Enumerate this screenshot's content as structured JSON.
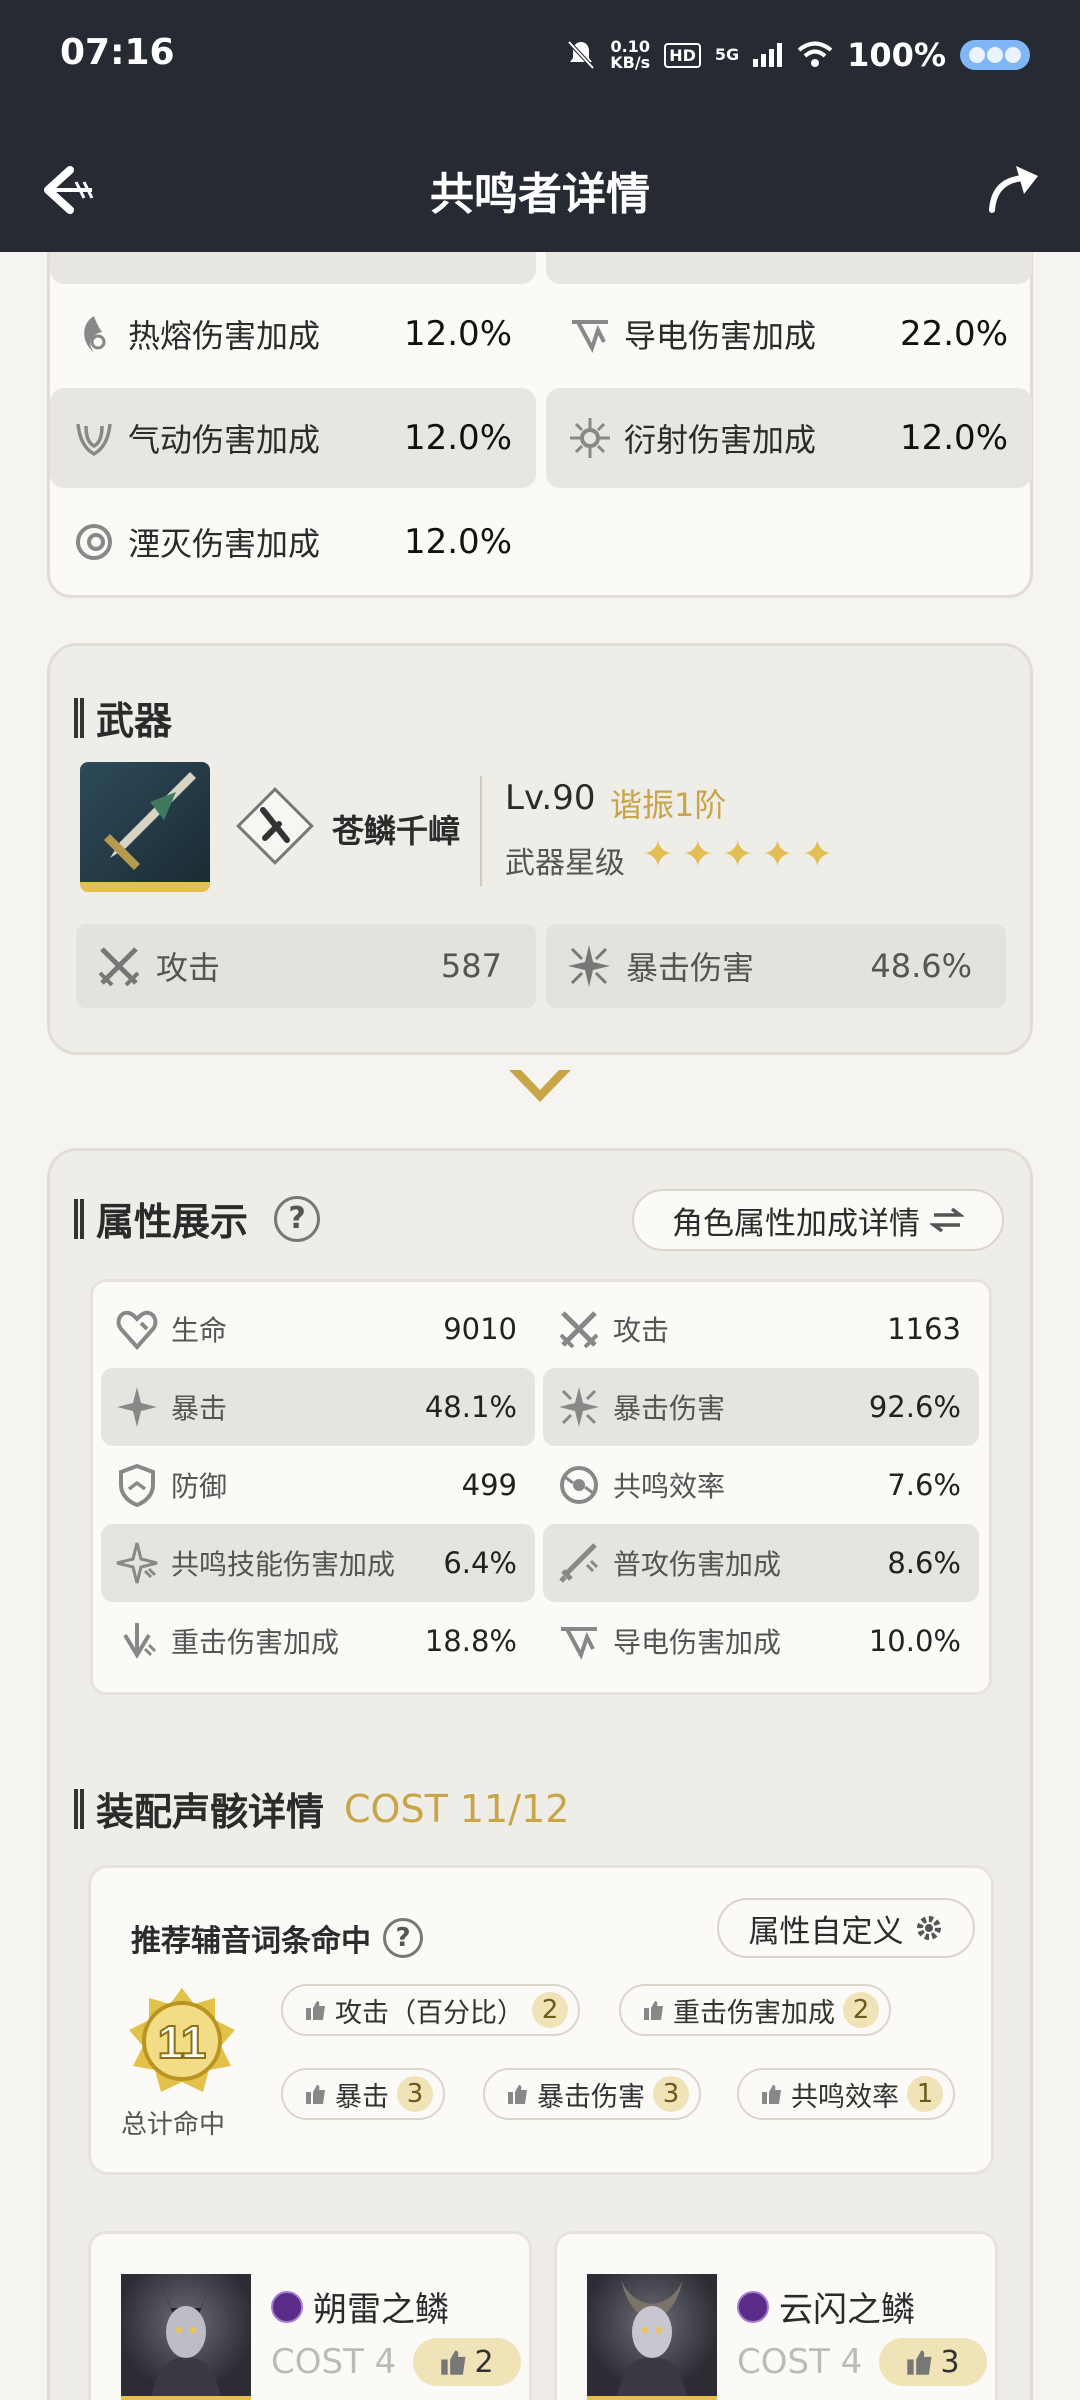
{
  "status": {
    "time": "07:16",
    "net_speed_value": "0.10",
    "net_speed_unit": "KB/s",
    "hd": "HD",
    "signal": "5G",
    "battery": "100%"
  },
  "header": {
    "title": "共鸣者详情"
  },
  "damage_card": {
    "rows": [
      {
        "label": "热熔伤害加成",
        "value": "12.0%",
        "icon": "fusion-icon"
      },
      {
        "label": "导电伤害加成",
        "value": "22.0%",
        "icon": "electro-icon"
      },
      {
        "label": "气动伤害加成",
        "value": "12.0%",
        "icon": "aero-icon"
      },
      {
        "label": "衍射伤害加成",
        "value": "12.0%",
        "icon": "spectro-icon"
      },
      {
        "label": "湮灭伤害加成",
        "value": "12.0%",
        "icon": "havoc-icon"
      }
    ]
  },
  "weapon": {
    "section_title": "武器",
    "name": "苍鳞千嶂",
    "level": "Lv.90",
    "tune": "谐振1阶",
    "star_label": "武器星级",
    "stars": 5,
    "stats": [
      {
        "label": "攻击",
        "value": "587",
        "icon": "attack-icon"
      },
      {
        "label": "暴击伤害",
        "value": "48.6%",
        "icon": "crit-damage-icon"
      }
    ]
  },
  "attributes": {
    "section_title": "属性展示",
    "help": "?",
    "detail_button": "角色属性加成详情",
    "rows": [
      {
        "label": "生命",
        "value": "9010",
        "icon": "hp-icon"
      },
      {
        "label": "攻击",
        "value": "1163",
        "icon": "attack-icon"
      },
      {
        "label": "暴击",
        "value": "48.1%",
        "icon": "crit-icon"
      },
      {
        "label": "暴击伤害",
        "value": "92.6%",
        "icon": "crit-damage-icon"
      },
      {
        "label": "防御",
        "value": "499",
        "icon": "defense-icon"
      },
      {
        "label": "共鸣效率",
        "value": "7.6%",
        "icon": "energy-regen-icon"
      },
      {
        "label": "共鸣技能伤害加成",
        "value": "6.4%",
        "icon": "skill-dmg-icon"
      },
      {
        "label": "普攻伤害加成",
        "value": "8.6%",
        "icon": "basic-attack-icon"
      },
      {
        "label": "重击伤害加成",
        "value": "18.8%",
        "icon": "heavy-attack-icon"
      },
      {
        "label": "导电伤害加成",
        "value": "10.0%",
        "icon": "electro-icon"
      }
    ]
  },
  "echoes": {
    "section_title": "装配声骸详情",
    "cost": "COST 11/12",
    "reco_title": "推荐辅音词条命中",
    "help": "?",
    "custom_button": "属性自定义",
    "total_hits": "11",
    "total_label": "总计命中",
    "tags": [
      {
        "label": "攻击（百分比）",
        "count": "2"
      },
      {
        "label": "重击伤害加成",
        "count": "2"
      },
      {
        "label": "暴击",
        "count": "3"
      },
      {
        "label": "暴击伤害",
        "count": "3"
      },
      {
        "label": "共鸣效率",
        "count": "1"
      }
    ],
    "cards": [
      {
        "name": "朔雷之鳞",
        "cost": "COST 4",
        "likes": "2"
      },
      {
        "name": "云闪之鳞",
        "cost": "COST 4",
        "likes": "3"
      }
    ]
  }
}
